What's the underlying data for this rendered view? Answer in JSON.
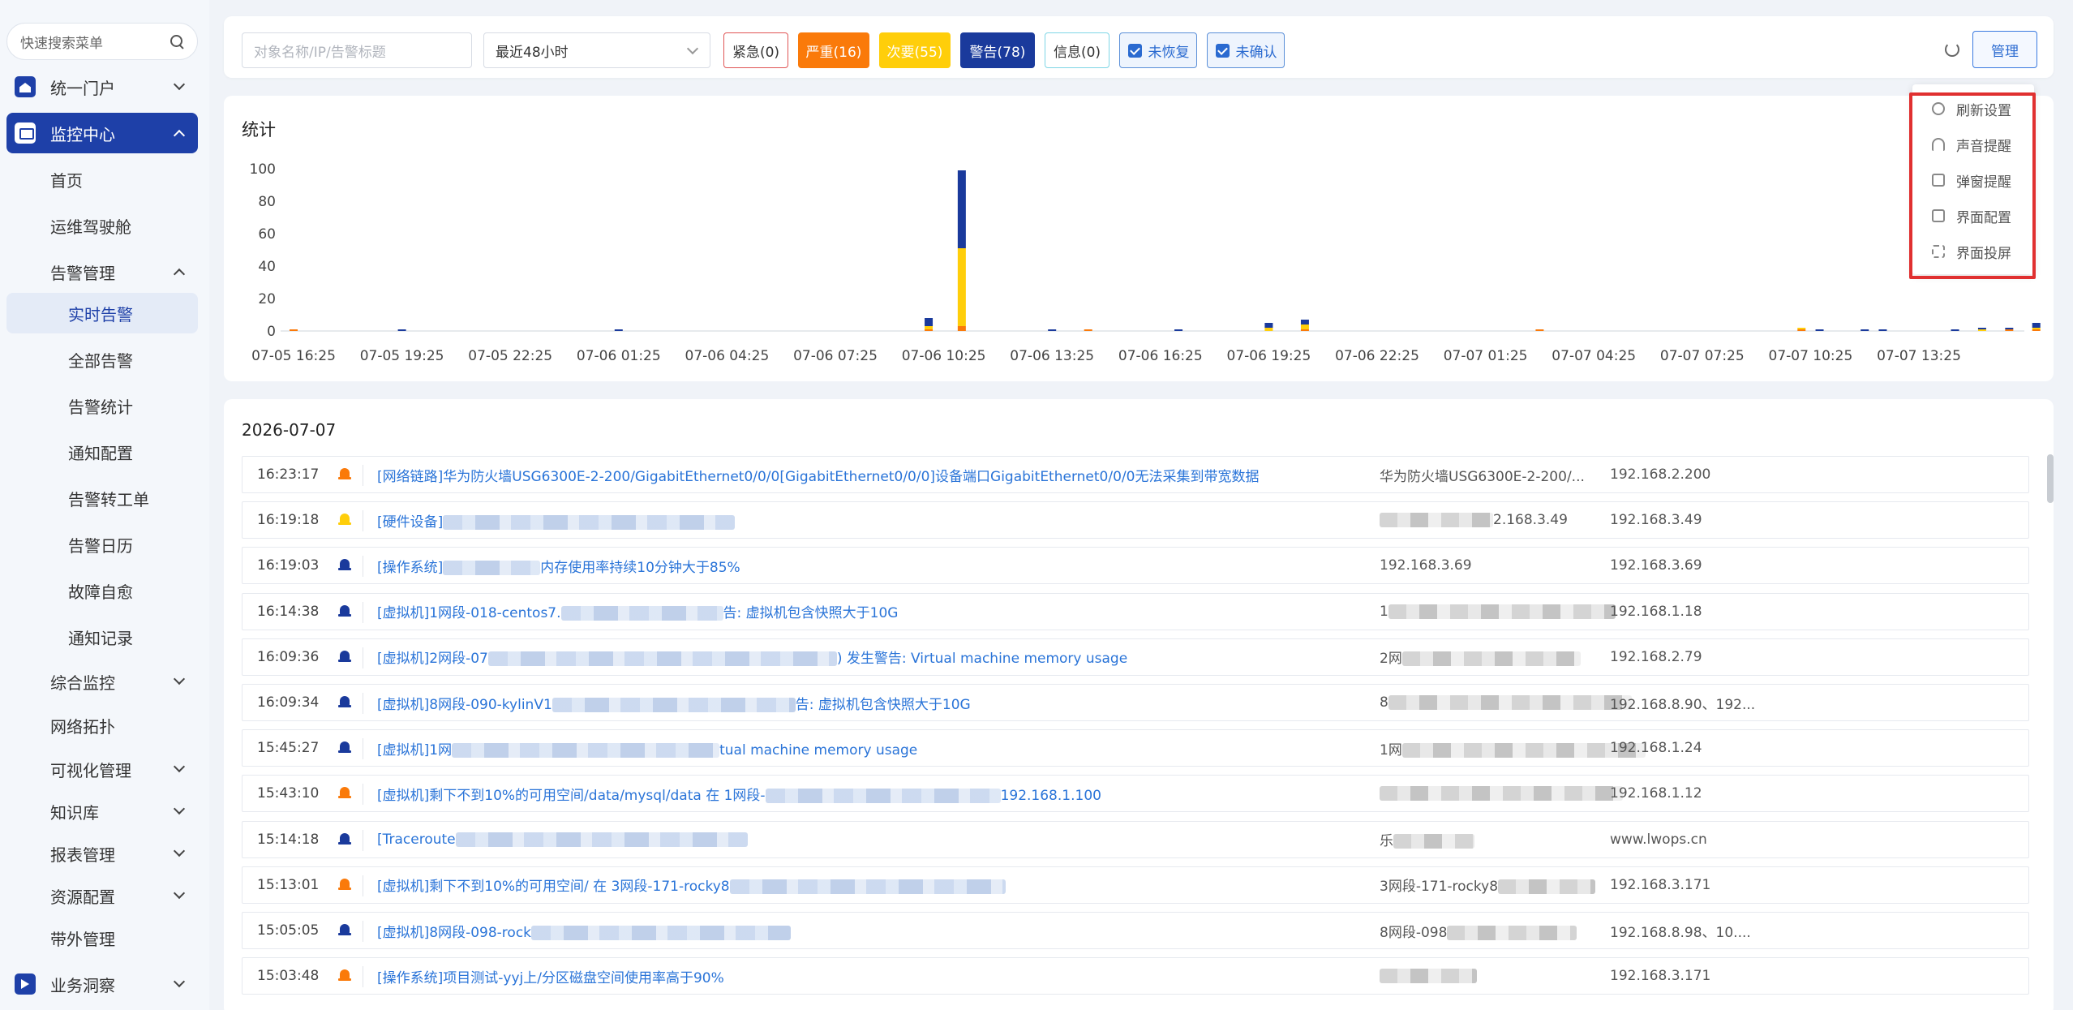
{
  "sidebar": {
    "search_placeholder": "快速搜索菜单",
    "items": [
      {
        "label": "统一门户"
      },
      {
        "label": "监控中心"
      },
      {
        "label": "首页"
      },
      {
        "label": "运维驾驶舱"
      },
      {
        "label": "告警管理"
      },
      {
        "label": "实时告警"
      },
      {
        "label": "全部告警"
      },
      {
        "label": "告警统计"
      },
      {
        "label": "通知配置"
      },
      {
        "label": "告警转工单"
      },
      {
        "label": "告警日历"
      },
      {
        "label": "故障自愈"
      },
      {
        "label": "通知记录"
      },
      {
        "label": "综合监控"
      },
      {
        "label": "网络拓扑"
      },
      {
        "label": "可视化管理"
      },
      {
        "label": "知识库"
      },
      {
        "label": "报表管理"
      },
      {
        "label": "资源配置"
      },
      {
        "label": "带外管理"
      },
      {
        "label": "业务洞察"
      }
    ]
  },
  "filters": {
    "search_placeholder": "对象名称/IP/告警标题",
    "time_range": "最近48小时",
    "tags": {
      "urgent": "紧急(0)",
      "severe": "严重(16)",
      "minor": "次要(55)",
      "warning": "警告(78)",
      "info": "信息(0)",
      "unrecovered": "未恢复",
      "unconfirmed": "未确认"
    },
    "manage_label": "管理"
  },
  "manage_menu": {
    "items": [
      "刷新设置",
      "声音提醒",
      "弹窗提醒",
      "界面配置",
      "界面投屏"
    ]
  },
  "stats": {
    "title": "统计"
  },
  "chart_data": {
    "type": "bar",
    "stacked": true,
    "ylim": [
      0,
      100
    ],
    "yticks": [
      0,
      20,
      40,
      60,
      80,
      100
    ],
    "x_tick_labels": [
      "07-05 16:25",
      "07-05 19:25",
      "07-05 22:25",
      "07-06 01:25",
      "07-06 04:25",
      "07-06 07:25",
      "07-06 10:25",
      "07-06 13:25",
      "07-06 16:25",
      "07-06 19:25",
      "07-06 22:25",
      "07-07 01:25",
      "07-07 04:25",
      "07-07 07:25",
      "07-07 10:25",
      "07-07 13:25"
    ],
    "colors": {
      "warning": "#1a3a9c",
      "minor": "#ffce0a",
      "severe": "#fa7a0a",
      "urgent": "#e03030"
    },
    "bars": [
      {
        "x": "07-05 16:25",
        "warning": 0,
        "minor": 0,
        "severe": 1,
        "urgent": 0
      },
      {
        "x": "07-05 19:25",
        "warning": 1,
        "minor": 0,
        "severe": 0,
        "urgent": 0
      },
      {
        "x": "07-06 01:25",
        "warning": 1,
        "minor": 0,
        "severe": 0,
        "urgent": 0
      },
      {
        "x": "07-06 10:00",
        "warning": 5,
        "minor": 2,
        "severe": 1,
        "urgent": 0
      },
      {
        "x": "07-06 10:55",
        "warning": 48,
        "minor": 48,
        "severe": 3,
        "urgent": 0
      },
      {
        "x": "07-06 13:25",
        "warning": 1,
        "minor": 0,
        "severe": 0,
        "urgent": 0
      },
      {
        "x": "07-06 14:25",
        "warning": 0,
        "minor": 0,
        "severe": 1,
        "urgent": 0
      },
      {
        "x": "07-06 16:55",
        "warning": 1,
        "minor": 0,
        "severe": 0,
        "urgent": 0
      },
      {
        "x": "07-06 19:25",
        "warning": 3,
        "minor": 2,
        "severe": 0,
        "urgent": 0
      },
      {
        "x": "07-06 20:25",
        "warning": 3,
        "minor": 3,
        "severe": 1,
        "urgent": 0
      },
      {
        "x": "07-07 02:55",
        "warning": 0,
        "minor": 0,
        "severe": 1,
        "urgent": 0
      },
      {
        "x": "07-07 10:10",
        "warning": 0,
        "minor": 1,
        "severe": 1,
        "urgent": 0
      },
      {
        "x": "07-07 10:40",
        "warning": 1,
        "minor": 0,
        "severe": 0,
        "urgent": 0
      },
      {
        "x": "07-07 11:55",
        "warning": 1,
        "minor": 0,
        "severe": 0,
        "urgent": 0
      },
      {
        "x": "07-07 12:25",
        "warning": 1,
        "minor": 0,
        "severe": 0,
        "urgent": 0
      },
      {
        "x": "07-07 14:25",
        "warning": 1,
        "minor": 0,
        "severe": 0,
        "urgent": 0
      },
      {
        "x": "07-07 15:10",
        "warning": 1,
        "minor": 1,
        "severe": 0,
        "urgent": 0
      },
      {
        "x": "07-07 15:55",
        "warning": 1,
        "minor": 0,
        "severe": 1,
        "urgent": 0
      },
      {
        "x": "07-07 16:40",
        "warning": 3,
        "minor": 1,
        "severe": 1,
        "urgent": 0
      },
      {
        "x": "07-07 17:25",
        "warning": 1,
        "minor": 0,
        "severe": 1,
        "urgent": 0
      },
      {
        "x": "07-07 17:55",
        "warning": 3,
        "minor": 2,
        "severe": 1,
        "urgent": 0
      }
    ]
  },
  "alarm_list": {
    "date": "2026-07-07",
    "rows": [
      {
        "time": "16:23:17",
        "level": "severe",
        "text": "[网络链路]华为防火墙USG6300E-2-200/GigabitEthernet0/0/0[GigabitEthernet0/0/0]设备端口GigabitEthernet0/0/0无法采集到带宽数据",
        "obj": "华为防火墙USG6300E-2-200/...",
        "ip": "192.168.2.200"
      },
      {
        "time": "16:19:18",
        "level": "minor",
        "text": "[硬件设备]",
        "obj": "2.168.3.49",
        "ip": "192.168.3.49"
      },
      {
        "time": "16:19:03",
        "level": "warning",
        "text": "[操作系统]",
        "text_tail": "内存使用率持续10分钟大于85%",
        "obj": "192.168.3.69",
        "ip": "192.168.3.69"
      },
      {
        "time": "16:14:38",
        "level": "warning",
        "text": "[虚拟机]1网段-018-centos7.",
        "text_tail": "告: 虚拟机包含快照大于10G",
        "obj": "1",
        "ip": "192.168.1.18"
      },
      {
        "time": "16:09:36",
        "level": "warning",
        "text": "[虚拟机]2网段-07",
        "text_tail": ") 发生警告: Virtual machine memory usage",
        "obj": "2网",
        "ip": "192.168.2.79"
      },
      {
        "time": "16:09:34",
        "level": "warning",
        "text": "[虚拟机]8网段-090-kylinV1",
        "text_tail": "告: 虚拟机包含快照大于10G",
        "obj": "8",
        "ip": "192.168.8.90、192..."
      },
      {
        "time": "15:45:27",
        "level": "warning",
        "text": "[虚拟机]1网",
        "text_tail": "tual machine memory usage",
        "obj": "1网",
        "ip": "192.168.1.24"
      },
      {
        "time": "15:43:10",
        "level": "severe",
        "text": "[虚拟机]剩下不到10%的可用空间/data/mysql/data 在 1网段-",
        "text_tail": "192.168.1.100",
        "obj": "",
        "ip": "192.168.1.12"
      },
      {
        "time": "15:14:18",
        "level": "warning",
        "text": "[Traceroute",
        "text_tail": "",
        "obj": "乐",
        "ip": "www.lwops.cn"
      },
      {
        "time": "15:13:01",
        "level": "severe",
        "text": "[虚拟机]剩下不到10%的可用空间/ 在 3网段-171-rocky8",
        "text_tail": "",
        "obj": "3网段-171-rocky8",
        "ip": "192.168.3.171"
      },
      {
        "time": "15:05:05",
        "level": "warning",
        "text": "[虚拟机]8网段-098-rock",
        "text_tail": "",
        "obj": "8网段-098",
        "ip": "192.168.8.98、10...."
      },
      {
        "time": "15:03:48",
        "level": "severe",
        "text": "[操作系统]项目测试-yyj上/分区磁盘空间使用率高于90%",
        "text_tail": "",
        "obj": "",
        "ip": "192.168.3.171"
      }
    ]
  }
}
